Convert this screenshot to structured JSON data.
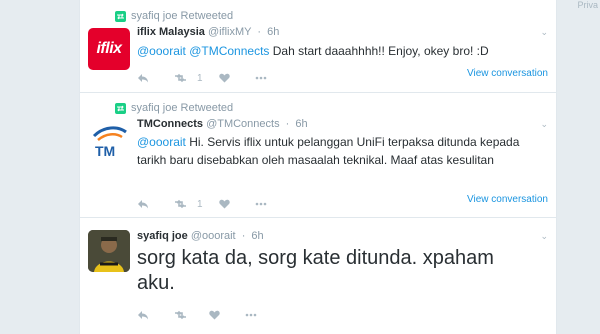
{
  "edge_text": "Priva",
  "tweets": [
    {
      "retweeted_by": "syafiq joe Retweeted",
      "name": "iflix Malaysia",
      "handle": "@iflixMY",
      "time": "6h",
      "mention": "@ooorait @TMConnects",
      "text": " Dah start daaahhhh!! Enjoy, okey bro! :D",
      "retweet_count": "1",
      "view_conversation": "View conversation",
      "avatar_text": "iflix"
    },
    {
      "retweeted_by": "syafiq joe Retweeted",
      "name": "TMConnects",
      "handle": "@TMConnects",
      "time": "6h",
      "mention": "@ooorait",
      "text": " Hi. Servis iflix untuk pelanggan UniFi terpaksa ditunda kepada tarikh baru disebabkan oleh masaalah teknikal. Maaf atas kesulitan",
      "retweet_count": "1",
      "view_conversation": "View conversation",
      "avatar_text": "TM"
    },
    {
      "name": "syafiq joe",
      "handle": "@ooorait",
      "time": "6h",
      "text": "sorg kata da, sorg kate ditunda. xpaham aku."
    }
  ],
  "colors": {
    "link": "#1b95e0",
    "retweet_green": "#19cf86",
    "iflix_red": "#e4002b"
  }
}
